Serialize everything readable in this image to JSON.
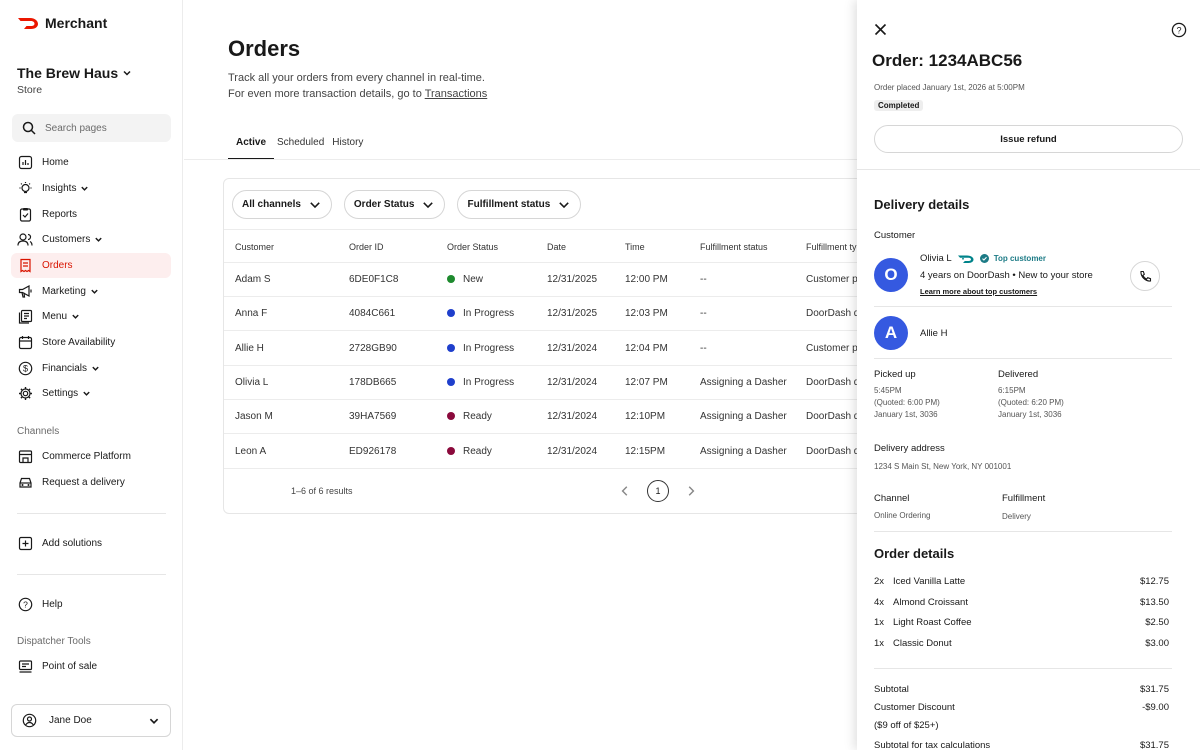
{
  "brand": {
    "name": "Merchant",
    "accent": "#eb1700"
  },
  "store": {
    "name": "The Brew Haus",
    "type": "Store"
  },
  "search": {
    "placeholder": "Search pages"
  },
  "nav": [
    {
      "label": "Home",
      "icon": "home-icon"
    },
    {
      "label": "Insights",
      "icon": "lightbulb-icon",
      "expandable": true
    },
    {
      "label": "Reports",
      "icon": "clipboard-icon"
    },
    {
      "label": "Customers",
      "icon": "users-icon",
      "expandable": true
    },
    {
      "label": "Orders",
      "icon": "receipt-icon",
      "active": true
    },
    {
      "label": "Marketing",
      "icon": "megaphone-icon",
      "expandable": true
    },
    {
      "label": "Menu",
      "icon": "menu-book-icon",
      "expandable": true
    },
    {
      "label": "Store Availability",
      "icon": "calendar-icon"
    },
    {
      "label": "Financials",
      "icon": "dollar-icon",
      "expandable": true
    },
    {
      "label": "Settings",
      "icon": "gear-icon",
      "expandable": true
    }
  ],
  "channels": {
    "label": "Channels",
    "items": [
      {
        "label": "Commerce Platform",
        "icon": "storefront-icon"
      },
      {
        "label": "Request a delivery",
        "icon": "car-icon"
      }
    ]
  },
  "add_solutions": "Add solutions",
  "help": "Help",
  "dispatcher": {
    "label": "Dispatcher Tools",
    "item": "Point of sale"
  },
  "user": {
    "name": "Jane Doe"
  },
  "page": {
    "title": "Orders",
    "desc1": "Track all your orders from every channel in real-time.",
    "desc2": "For even more transaction details, go to ",
    "link": "Transactions"
  },
  "tabs": [
    "Active",
    "Scheduled",
    "History"
  ],
  "filters": [
    "All channels",
    "Order Status",
    "Fulfillment status"
  ],
  "table": {
    "headers": [
      "Customer",
      "Order ID",
      "Order Status",
      "Date",
      "Time",
      "Fulfillment status",
      "Fulfillment ty"
    ],
    "rows": [
      {
        "customer": "Adam S",
        "id": "6DE0F1C8",
        "status": "New",
        "status_color": "#1e8a2e",
        "date": "12/31/2025",
        "time": "12:00 PM",
        "fstatus": "--",
        "ftype": "Customer p"
      },
      {
        "customer": "Anna F",
        "id": "4084C661",
        "status": "In Progress",
        "status_color": "#1f3fcc",
        "date": "12/31/2025",
        "time": "12:03 PM",
        "fstatus": "--",
        "ftype": "DoorDash d"
      },
      {
        "customer": "Allie H",
        "id": "2728GB90",
        "status": "In Progress",
        "status_color": "#1f3fcc",
        "date": "12/31/2024",
        "time": "12:04 PM",
        "fstatus": "--",
        "ftype": "Customer p"
      },
      {
        "customer": "Olivia L",
        "id": "178DB665",
        "status": "In Progress",
        "status_color": "#1f3fcc",
        "date": "12/31/2024",
        "time": "12:07 PM",
        "fstatus": "Assigning a Dasher",
        "ftype": "DoorDash d"
      },
      {
        "customer": "Jason M",
        "id": "39HA7569",
        "status": "Ready",
        "status_color": "#8b0a3c",
        "date": "12/31/2024",
        "time": "12:10PM",
        "fstatus": "Assigning a Dasher",
        "ftype": "DoorDash d"
      },
      {
        "customer": "Leon A",
        "id": "ED926178",
        "status": "Ready",
        "status_color": "#8b0a3c",
        "date": "12/31/2024",
        "time": "12:15PM",
        "fstatus": "Assigning a Dasher",
        "ftype": "DoorDash d"
      }
    ],
    "results": "1–6 of 6 results",
    "page": "1"
  },
  "panel": {
    "order_title": "Order: 1234ABC56",
    "placed": "Order placed January 1st, 2026 at 5:00PM",
    "badge": "Completed",
    "refund": "Issue refund",
    "delivery_heading": "Delivery details",
    "customer_label": "Customer",
    "customer": {
      "initial": "O",
      "name": "Olivia L",
      "badge": "Top customer",
      "tenure": "4 years on DoorDash • New to your store",
      "learn": "Learn more about top customers"
    },
    "dasher": {
      "initial": "A",
      "name": "Allie H"
    },
    "picked_up": {
      "label": "Picked up",
      "time": "5:45PM",
      "quoted": "(Quoted: 6:00 PM)",
      "date": "January 1st, 3036"
    },
    "delivered": {
      "label": "Delivered",
      "time": "6:15PM",
      "quoted": "(Quoted: 6:20 PM)",
      "date": "January 1st, 3036"
    },
    "address_label": "Delivery address",
    "address": "1234 S Main St, New York, NY 001001",
    "channel_label": "Channel",
    "channel": "Online Ordering",
    "fulfillment_label": "Fulfillment",
    "fulfillment": "Delivery",
    "order_heading": "Order details",
    "items": [
      {
        "qty": "2x",
        "name": "Iced Vanilla Latte",
        "price": "$12.75"
      },
      {
        "qty": "4x",
        "name": "Almond Croissant",
        "price": "$13.50"
      },
      {
        "qty": "1x",
        "name": "Light Roast Coffee",
        "price": "$2.50"
      },
      {
        "qty": "1x",
        "name": "Classic Donut",
        "price": "$3.00"
      }
    ],
    "subtotal": {
      "label": "Subtotal",
      "value": "$31.75"
    },
    "discount": {
      "label": "Customer Discount",
      "value": "-$9.00",
      "note": "($9 off of $25+)"
    },
    "tax_subtotal": {
      "label": "Subtotal for tax calculations",
      "value": "$31.75"
    }
  }
}
